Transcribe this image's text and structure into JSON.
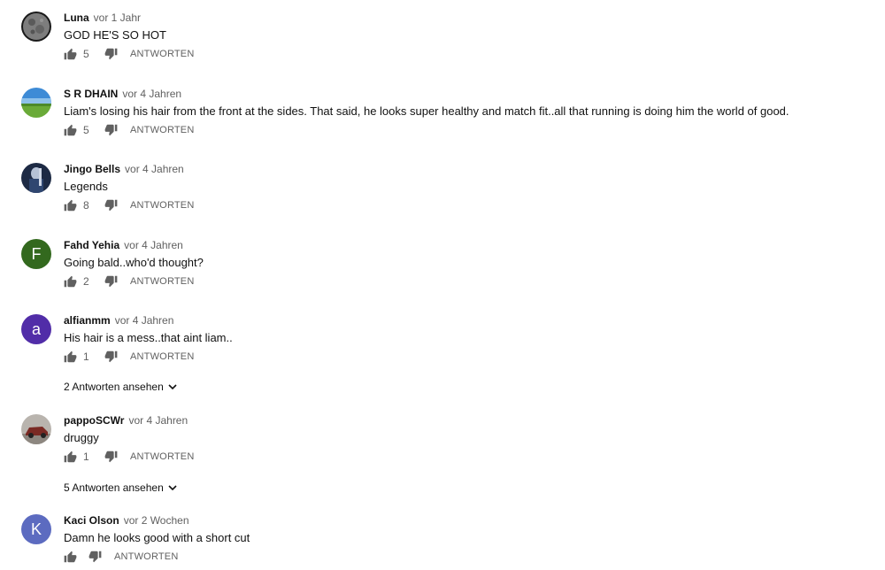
{
  "comments": [
    {
      "author": "Luna",
      "time": "vor 1 Jahr",
      "text": "GOD HE'S SO HOT",
      "likes": "5",
      "reply_label": "ANTWORTEN",
      "avatar": {
        "kind": "image",
        "desc": "moon-photo",
        "colors": [
          "#8a8a8a",
          "#3a3a3a"
        ]
      }
    },
    {
      "author": "S R DHAIN",
      "time": "vor 4 Jahren",
      "text": "Liam's losing his hair from the front at the sides. That said, he looks super healthy and match fit..all that running is doing him the world of good.",
      "likes": "5",
      "reply_label": "ANTWORTEN",
      "avatar": {
        "kind": "image",
        "desc": "landscape-photo",
        "colors": [
          "#3d8bd6",
          "#6aaa38"
        ]
      }
    },
    {
      "author": "Jingo Bells",
      "time": "vor 4 Jahren",
      "text": "Legends",
      "likes": "8",
      "reply_label": "ANTWORTEN",
      "avatar": {
        "kind": "image",
        "desc": "person-photo",
        "colors": [
          "#1d2a44",
          "#b6c2d6"
        ]
      }
    },
    {
      "author": "Fahd Yehia",
      "time": "vor 4 Jahren",
      "text": "Going bald..who'd thought?",
      "likes": "2",
      "reply_label": "ANTWORTEN",
      "avatar": {
        "kind": "letter",
        "letter": "F",
        "color": "#33691e"
      }
    },
    {
      "author": "alfianmm",
      "time": "vor 4 Jahren",
      "text": "His hair is a mess..that aint liam..",
      "likes": "1",
      "reply_label": "ANTWORTEN",
      "avatar": {
        "kind": "letter",
        "letter": "a",
        "color": "#512da8"
      },
      "replies_label": "2 Antworten ansehen"
    },
    {
      "author": "pappoSCWr",
      "time": "vor 4 Jahren",
      "text": "druggy",
      "likes": "1",
      "reply_label": "ANTWORTEN",
      "avatar": {
        "kind": "image",
        "desc": "car-photo",
        "colors": [
          "#b9b4ae",
          "#7a2a24"
        ]
      },
      "replies_label": "5 Antworten ansehen"
    },
    {
      "author": "Kaci Olson",
      "time": "vor 2 Wochen",
      "text": "Damn he looks good with a short cut",
      "likes": "",
      "reply_label": "ANTWORTEN",
      "avatar": {
        "kind": "letter",
        "letter": "K",
        "color": "#5c6bc0"
      }
    }
  ],
  "icons": {
    "like": "thumbs-up-icon",
    "dislike": "thumbs-down-icon",
    "expand": "chevron-down-icon"
  },
  "colors": {
    "meta_text": "#606060",
    "text": "#111111"
  }
}
